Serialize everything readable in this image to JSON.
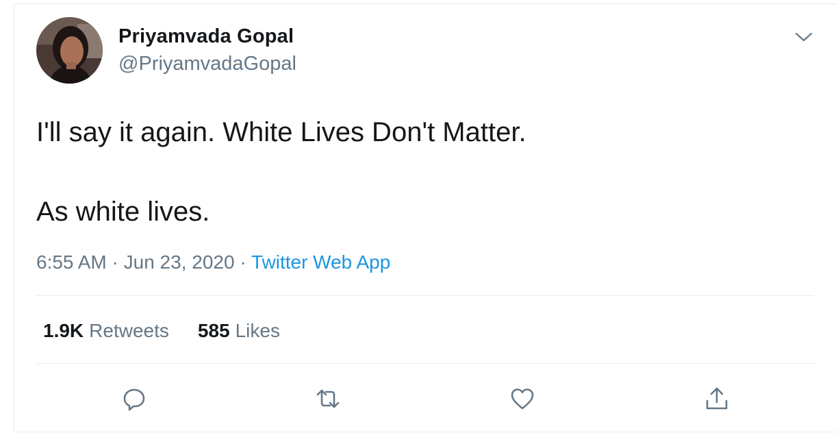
{
  "tweet": {
    "author": {
      "display_name": "Priyamvada Gopal",
      "handle": "@PriyamvadaGopal",
      "avatar_icon": "profile-photo"
    },
    "text": "I'll say it again. White Lives Don't Matter.\n\nAs white lives.",
    "time": "6:55 AM",
    "separator": "·",
    "date": "Jun 23, 2020",
    "source": "Twitter Web App",
    "stats": {
      "retweets_count": "1.9K",
      "retweets_label": "Retweets",
      "likes_count": "585",
      "likes_label": "Likes"
    },
    "actions": [
      {
        "name": "reply",
        "icon": "reply-icon"
      },
      {
        "name": "retweet",
        "icon": "retweet-icon"
      },
      {
        "name": "like",
        "icon": "heart-icon"
      },
      {
        "name": "share",
        "icon": "share-icon"
      }
    ],
    "more_icon": "chevron-down-icon"
  },
  "colors": {
    "text_primary": "#14171a",
    "text_secondary": "#657786",
    "link": "#1b95e0",
    "border": "#e6ecf0"
  }
}
